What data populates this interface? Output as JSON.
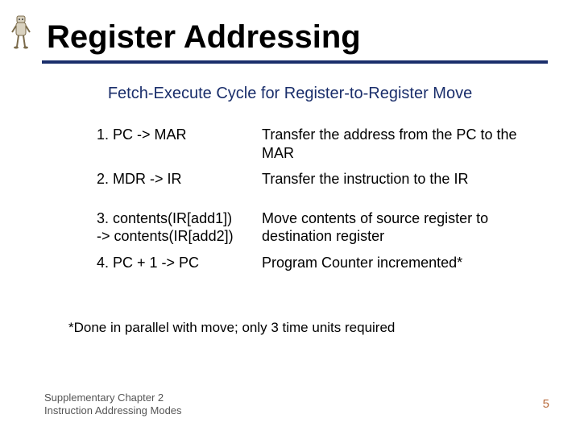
{
  "title": "Register Addressing",
  "subtitle": "Fetch-Execute Cycle for Register-to-Register Move",
  "steps": [
    {
      "left": "1.  PC -> MAR",
      "right": "Transfer the address from the PC to the MAR"
    },
    {
      "left": "2.  MDR -> IR",
      "right": "Transfer the instruction to the IR"
    },
    {
      "left": "3. contents(IR[add1])\n    -> contents(IR[add2])",
      "right": "Move contents of source register to destination register"
    },
    {
      "left": "4.  PC + 1 -> PC",
      "right": "Program Counter incremented*"
    }
  ],
  "footnote": "*Done in parallel with move; only 3 time units required",
  "footer_line1": "Supplementary Chapter 2",
  "footer_line2": "Instruction Addressing Modes",
  "page_number": "5",
  "icon_name": "robot-figure-icon"
}
